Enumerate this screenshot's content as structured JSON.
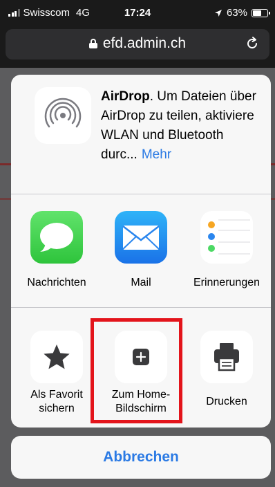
{
  "status_bar": {
    "carrier": "Swisscom",
    "network": "4G",
    "time": "17:24",
    "battery": "63%",
    "battery_level": 0.63
  },
  "browser": {
    "url": "efd.admin.ch"
  },
  "share_sheet": {
    "airdrop": {
      "title": "AirDrop",
      "message": ". Um Dateien über AirDrop zu teilen, aktiviere WLAN und Bluetooth durc...",
      "more_label": "Mehr"
    },
    "apps": [
      {
        "label": "Nachrichten",
        "icon": "messages-icon"
      },
      {
        "label": "Mail",
        "icon": "mail-icon"
      },
      {
        "label": "Erinnerungen",
        "icon": "reminders-icon"
      }
    ],
    "actions": [
      {
        "label_line1": "Als Favorit",
        "label_line2": "sichern",
        "icon": "star-icon"
      },
      {
        "label_line1": "Zum Home-",
        "label_line2": "Bildschirm",
        "icon": "add-square-icon"
      },
      {
        "label_line1": "Drucken",
        "label_line2": "",
        "icon": "printer-icon"
      }
    ],
    "highlight_color": "#e3141b"
  },
  "cancel_label": "Abbrechen",
  "colors": {
    "accent": "#2b7ae4",
    "sheet_background": "#f7f7f7"
  }
}
